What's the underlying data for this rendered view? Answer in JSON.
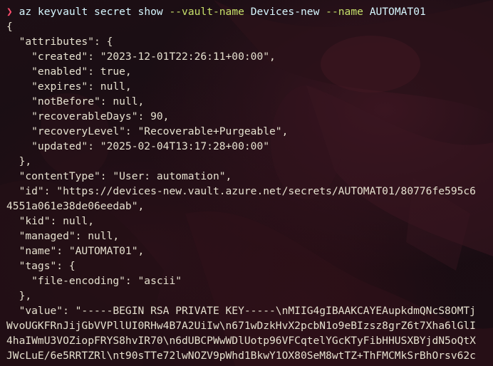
{
  "prompt_symbol": "❯",
  "command": {
    "program": "az keyvault secret show",
    "flag_vault": "--vault-name",
    "vault_value": "Devices-new",
    "flag_name": "--name",
    "name_value": "AUTOMAT01"
  },
  "output_lines": [
    "{",
    "  \"attributes\": {",
    "    \"created\": \"2023-12-01T22:26:11+00:00\",",
    "    \"enabled\": true,",
    "    \"expires\": null,",
    "    \"notBefore\": null,",
    "    \"recoverableDays\": 90,",
    "    \"recoveryLevel\": \"Recoverable+Purgeable\",",
    "    \"updated\": \"2025-02-04T13:17:28+00:00\"",
    "  },",
    "  \"contentType\": \"User: automation\",",
    "  \"id\": \"https://devices-new.vault.azure.net/secrets/AUTOMAT01/80776fe595c6",
    "4551a061e38de06eedab\",",
    "  \"kid\": null,",
    "  \"managed\": null,",
    "  \"name\": \"AUTOMAT01\",",
    "  \"tags\": {",
    "    \"file-encoding\": \"ascii\"",
    "  },",
    "  \"value\": \"-----BEGIN RSA PRIVATE KEY-----\\nMIIG4gIBAAKCAYEAupkdmQNcS8OMTj",
    "WvoUGKFRnJijGbVVPllUI0RHw4B7A2UiIw\\n671wDzkHvX2pcbN1o9eBIzsz8grZ6t7Xha6lGlI",
    "4haIWmU3VOZiopFRYS8hvIR70\\n6dUBCPWwWDlUotp96VFCqtelYGcKTyFibHHUSXBYjdN5oQtX",
    "JWcLuE/6e5RRTZRl\\nt90sTTe72lwNOZV9pWhd1BkwY1OX80SeM8wtTZ+ThFMCMkSrBhOrsv62c"
  ]
}
